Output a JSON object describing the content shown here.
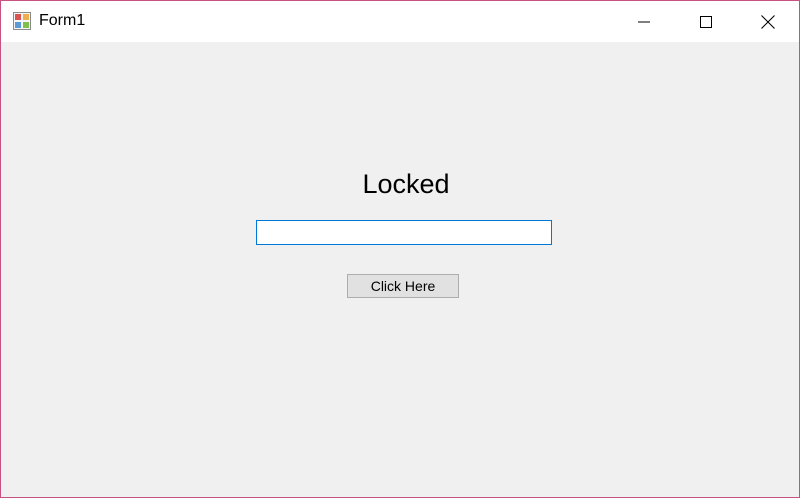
{
  "window": {
    "title": "Form1",
    "border_color": "#c7517f",
    "titlebar_color": "#ffffff",
    "client_color": "#f0f0f0"
  },
  "titlebar": {
    "app_icon": "winforms-app-icon",
    "minimize_icon": "minimize-icon",
    "maximize_icon": "maximize-icon",
    "close_icon": "close-icon"
  },
  "form": {
    "label_text": "Locked",
    "textbox_value": "",
    "textbox_border_color": "#0078d7",
    "button_label": "Click Here"
  }
}
